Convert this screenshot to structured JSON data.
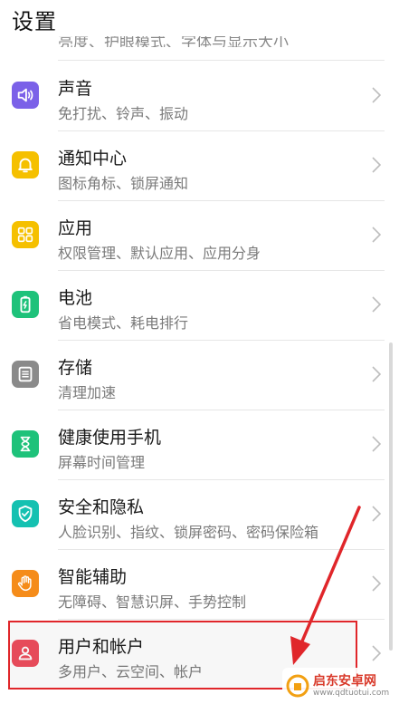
{
  "header": {
    "title": "设置"
  },
  "cut_item": {
    "subtitle": "亮度、护眼模式、字体与显示大小"
  },
  "items": [
    {
      "title": "声音",
      "subtitle": "免打扰、铃声、振动",
      "icon": "speaker-icon",
      "color": "#7b61e8"
    },
    {
      "title": "通知中心",
      "subtitle": "图标角标、锁屏通知",
      "icon": "bell-icon",
      "color": "#f5c000"
    },
    {
      "title": "应用",
      "subtitle": "权限管理、默认应用、应用分身",
      "icon": "apps-grid-icon",
      "color": "#f5c000"
    },
    {
      "title": "电池",
      "subtitle": "省电模式、耗电排行",
      "icon": "battery-icon",
      "color": "#1ec27a"
    },
    {
      "title": "存储",
      "subtitle": "清理加速",
      "icon": "storage-icon",
      "color": "#8a8a8a"
    },
    {
      "title": "健康使用手机",
      "subtitle": "屏幕时间管理",
      "icon": "hourglass-icon",
      "color": "#1ec27a"
    },
    {
      "title": "安全和隐私",
      "subtitle": "人脸识别、指纹、锁屏密码、密码保险箱",
      "icon": "shield-icon",
      "color": "#15c1b1"
    },
    {
      "title": "智能辅助",
      "subtitle": "无障碍、智慧识屏、手势控制",
      "icon": "hand-icon",
      "color": "#f58c1a"
    },
    {
      "title": "用户和帐户",
      "subtitle": "多用户、云空间、帐户",
      "icon": "user-icon",
      "color": "#ee4e5d"
    }
  ],
  "annotation": {
    "highlight_color": "#e0262a"
  },
  "watermark": {
    "name": "启东安卓网",
    "url": "www.qdtuotui.com"
  }
}
